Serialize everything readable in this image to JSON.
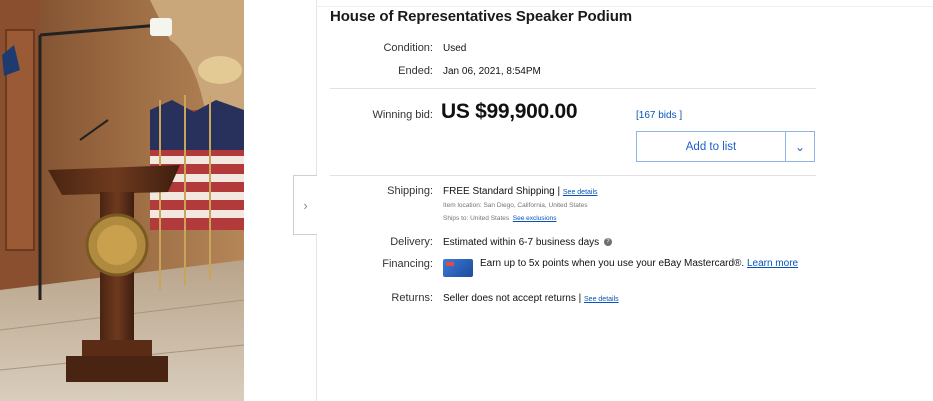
{
  "listing": {
    "title": "House of Representatives Speaker Podium",
    "condition_label": "Condition:",
    "condition_value": "Used",
    "ended_label": "Ended:",
    "ended_value": "Jan 06, 2021, 8:54PM",
    "winning_bid_label": "Winning bid:",
    "winning_bid_value": "US $99,900.00",
    "bids_link": "[167 bids ]",
    "add_to_list": "Add to list"
  },
  "shipping": {
    "label": "Shipping:",
    "value": "FREE  Standard Shipping |",
    "details_link": "See details",
    "item_location": "Item location:  San Diego, California, United States",
    "ships_to": "Ships to:  United States",
    "exclusions_link": "See exclusions"
  },
  "delivery": {
    "label": "Delivery:",
    "value": "Estimated within 6-7 business days"
  },
  "financing": {
    "label": "Financing:",
    "text": "Earn up to 5x points when you use your eBay Mastercard®. ",
    "learn_more": "Learn more"
  },
  "returns": {
    "label": "Returns:",
    "value": "Seller does not accept returns |",
    "details_link": "See details"
  },
  "icons": {
    "next": "chevron-right-icon",
    "dropdown": "chevron-down-icon",
    "info": "info-icon",
    "card": "credit-card-icon"
  },
  "colors": {
    "link": "#0654ba",
    "button_border": "#8fb4e8",
    "button_text": "#1f5fc8"
  }
}
